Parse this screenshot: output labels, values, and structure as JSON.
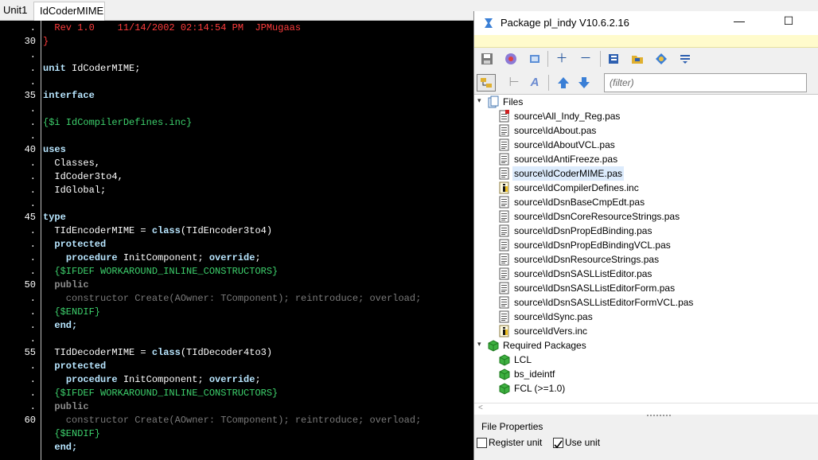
{
  "tabs": [
    {
      "label": "Unit1"
    },
    {
      "label": "IdCoderMIME"
    }
  ],
  "gutter": [
    ".",
    "30",
    ".",
    ".",
    ".",
    "35",
    ".",
    ".",
    ".",
    "40",
    ".",
    ".",
    ".",
    ".",
    "45",
    ".",
    ".",
    ".",
    ".",
    "50",
    ".",
    ".",
    ".",
    ".",
    "55",
    ".",
    ".",
    ".",
    ".",
    "60"
  ],
  "code": [
    [
      {
        "t": "  Rev 1.0    11/14/2002 02:14:54 PM  JPMugaas",
        "c": "#ff3c3c"
      }
    ],
    [
      {
        "t": "}",
        "c": "#ff3c3c"
      }
    ],
    [
      {
        "t": "",
        "c": "#fff"
      }
    ],
    [
      {
        "t": "unit",
        "c": "#b8e6ff",
        "b": true
      },
      {
        "t": " IdCoderMIME;",
        "c": "#ffffff"
      }
    ],
    [
      {
        "t": "",
        "c": "#fff"
      }
    ],
    [
      {
        "t": "interface",
        "c": "#b8e6ff",
        "b": true
      }
    ],
    [
      {
        "t": "",
        "c": "#fff"
      }
    ],
    [
      {
        "t": "{$i IdCompilerDefines.inc}",
        "c": "#3dd06c"
      }
    ],
    [
      {
        "t": "",
        "c": "#fff"
      }
    ],
    [
      {
        "t": "uses",
        "c": "#b8e6ff",
        "b": true
      }
    ],
    [
      {
        "t": "  Classes,",
        "c": "#ffffff"
      }
    ],
    [
      {
        "t": "  IdCoder3to4,",
        "c": "#ffffff"
      }
    ],
    [
      {
        "t": "  IdGlobal;",
        "c": "#ffffff"
      }
    ],
    [
      {
        "t": "",
        "c": "#fff"
      }
    ],
    [
      {
        "t": "type",
        "c": "#b8e6ff",
        "b": true
      }
    ],
    [
      {
        "t": "  TIdEncoderMIME = ",
        "c": "#ffffff"
      },
      {
        "t": "class",
        "c": "#b8e6ff",
        "b": true
      },
      {
        "t": "(TIdEncoder3to4)",
        "c": "#ffffff"
      }
    ],
    [
      {
        "t": "  protected",
        "c": "#b8e6ff",
        "b": true
      }
    ],
    [
      {
        "t": "    ",
        "c": "#fff"
      },
      {
        "t": "procedure",
        "c": "#b8e6ff",
        "b": true
      },
      {
        "t": " InitComponent; ",
        "c": "#ffffff"
      },
      {
        "t": "override",
        "c": "#b8e6ff",
        "b": true
      },
      {
        "t": ";",
        "c": "#ffffff"
      }
    ],
    [
      {
        "t": "  {$IFDEF WORKAROUND_INLINE_CONSTRUCTORS}",
        "c": "#3dd06c"
      }
    ],
    [
      {
        "t": "  public",
        "c": "#8c8c8c",
        "b": true
      }
    ],
    [
      {
        "t": "    constructor Create(AOwner: TComponent); reintroduce; overload;",
        "c": "#7a7a7a"
      }
    ],
    [
      {
        "t": "  {$ENDIF}",
        "c": "#3dd06c"
      }
    ],
    [
      {
        "t": "  end;",
        "c": "#b8e6ff",
        "b": true
      }
    ],
    [
      {
        "t": "",
        "c": "#fff"
      }
    ],
    [
      {
        "t": "  TIdDecoderMIME = ",
        "c": "#ffffff"
      },
      {
        "t": "class",
        "c": "#b8e6ff",
        "b": true
      },
      {
        "t": "(TIdDecoder4to3)",
        "c": "#ffffff"
      }
    ],
    [
      {
        "t": "  protected",
        "c": "#b8e6ff",
        "b": true
      }
    ],
    [
      {
        "t": "    ",
        "c": "#fff"
      },
      {
        "t": "procedure",
        "c": "#b8e6ff",
        "b": true
      },
      {
        "t": " InitComponent; ",
        "c": "#ffffff"
      },
      {
        "t": "override",
        "c": "#b8e6ff",
        "b": true
      },
      {
        "t": ";",
        "c": "#ffffff"
      }
    ],
    [
      {
        "t": "  {$IFDEF WORKAROUND_INLINE_CONSTRUCTORS}",
        "c": "#3dd06c"
      }
    ],
    [
      {
        "t": "  public",
        "c": "#8c8c8c",
        "b": true
      }
    ],
    [
      {
        "t": "    constructor Create(AOwner: TComponent); reintroduce; overload;",
        "c": "#7a7a7a"
      }
    ],
    [
      {
        "t": "  {$ENDIF}",
        "c": "#3dd06c"
      }
    ],
    [
      {
        "t": "  end;",
        "c": "#b8e6ff",
        "b": true
      }
    ]
  ],
  "package": {
    "title": "Package pl_indy V10.6.2.16",
    "window_buttons": {
      "minimize": "—",
      "maximize": "☐"
    },
    "filter_placeholder": "(filter)",
    "files_label": "Files",
    "files": [
      {
        "name": "source\\All_Indy_Reg.pas",
        "kind": "reg"
      },
      {
        "name": "source\\IdAbout.pas",
        "kind": "pas"
      },
      {
        "name": "source\\IdAboutVCL.pas",
        "kind": "pas"
      },
      {
        "name": "source\\IdAntiFreeze.pas",
        "kind": "pas"
      },
      {
        "name": "source\\IdCoderMIME.pas",
        "kind": "pas",
        "selected": true
      },
      {
        "name": "source\\IdCompilerDefines.inc",
        "kind": "inc"
      },
      {
        "name": "source\\IdDsnBaseCmpEdt.pas",
        "kind": "pas"
      },
      {
        "name": "source\\IdDsnCoreResourceStrings.pas",
        "kind": "pas"
      },
      {
        "name": "source\\IdDsnPropEdBinding.pas",
        "kind": "pas"
      },
      {
        "name": "source\\IdDsnPropEdBindingVCL.pas",
        "kind": "pas"
      },
      {
        "name": "source\\IdDsnResourceStrings.pas",
        "kind": "pas"
      },
      {
        "name": "source\\IdDsnSASLListEditor.pas",
        "kind": "pas"
      },
      {
        "name": "source\\IdDsnSASLListEditorForm.pas",
        "kind": "pas"
      },
      {
        "name": "source\\IdDsnSASLListEditorFormVCL.pas",
        "kind": "pas"
      },
      {
        "name": "source\\IdSync.pas",
        "kind": "pas"
      },
      {
        "name": "source\\IdVers.inc",
        "kind": "inc"
      }
    ],
    "required_label": "Required Packages",
    "required": [
      {
        "name": "LCL"
      },
      {
        "name": "bs_ideintf"
      },
      {
        "name": "FCL (>=1.0)"
      }
    ],
    "props_title": "File Properties",
    "register_unit": "Register unit",
    "use_unit": "Use unit",
    "use_unit_checked": true,
    "register_unit_checked": false
  }
}
